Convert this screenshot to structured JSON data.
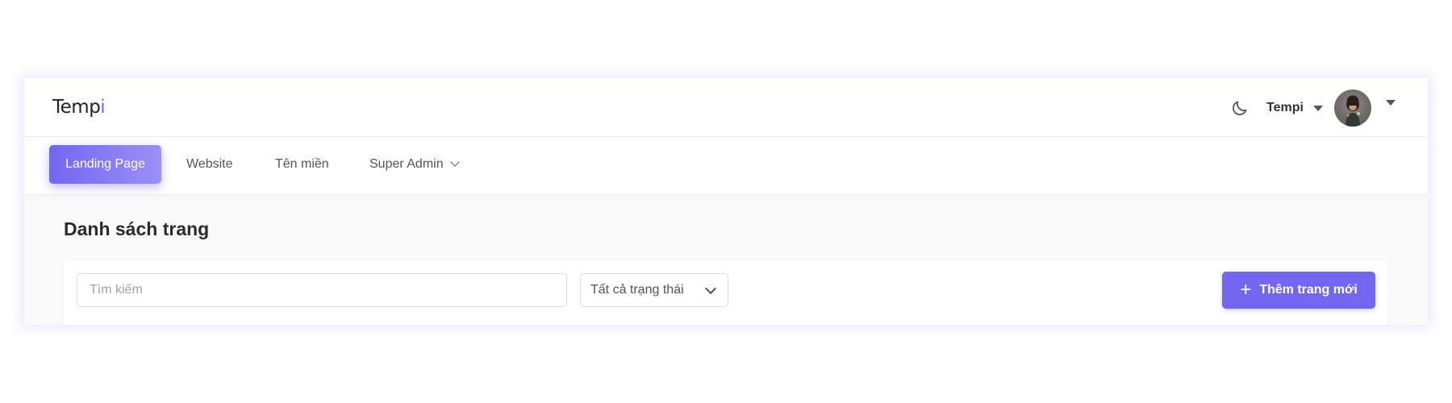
{
  "header": {
    "logo_main": "Temp",
    "logo_accent": "i",
    "theme_toggle_icon": "moon-icon",
    "user_name": "Tempi",
    "avatar_icon": "user-avatar"
  },
  "nav": {
    "items": [
      {
        "label": "Landing Page",
        "active": true
      },
      {
        "label": "Website",
        "active": false
      },
      {
        "label": "Tên miền",
        "active": false
      },
      {
        "label": "Super Admin",
        "active": false,
        "has_dropdown": true
      }
    ]
  },
  "main": {
    "title": "Danh sách trang",
    "search": {
      "placeholder": "Tìm kiếm",
      "value": ""
    },
    "status_filter": {
      "selected": "Tất cả trạng thái"
    },
    "add_button": {
      "icon": "plus-icon",
      "label": "Thêm trang mới"
    }
  },
  "colors": {
    "accent": "#7367f0",
    "accent_light": "#9a90f5",
    "background": "#fafafb"
  }
}
